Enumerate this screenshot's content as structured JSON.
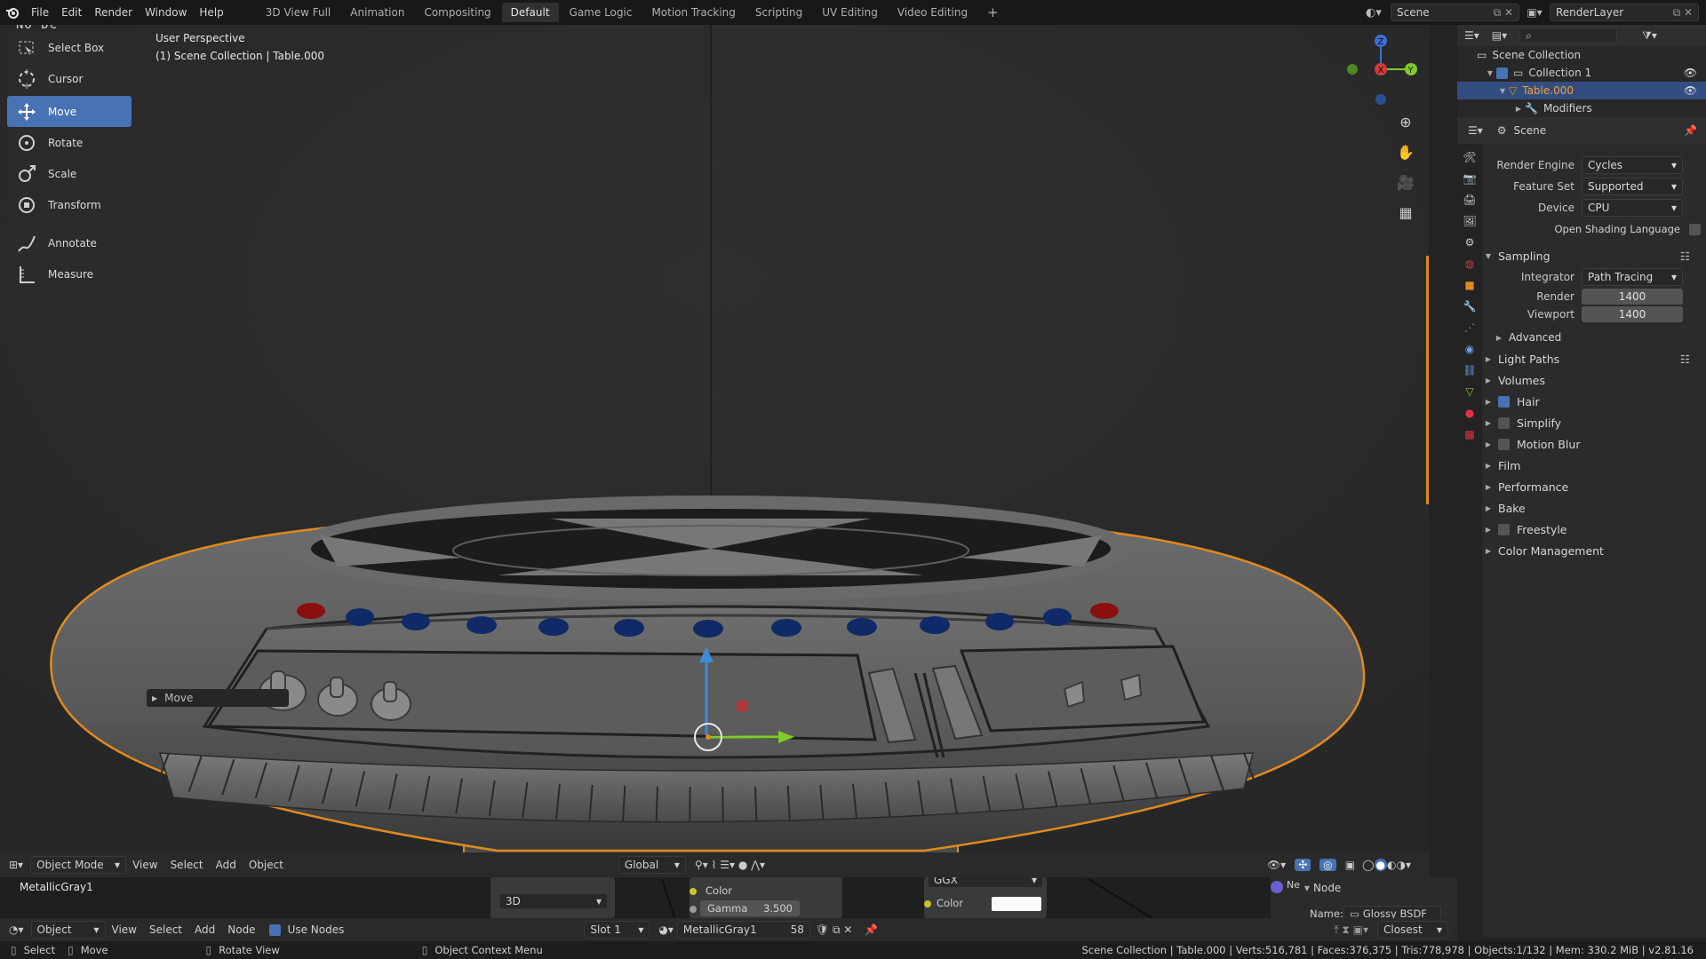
{
  "menu": {
    "items": [
      "File",
      "Edit",
      "Render",
      "Window",
      "Help"
    ],
    "workspaces": [
      "3D View Full",
      "Animation",
      "Compositing",
      "Default",
      "Game Logic",
      "Motion Tracking",
      "Scripting",
      "UV Editing",
      "Video Editing"
    ],
    "active_workspace": "Default",
    "add_tab": "+",
    "scene_name": "Scene",
    "render_layer": "RenderLayer"
  },
  "viewport": {
    "watermark": "NO DC",
    "perspective": "User Perspective",
    "collection_info": "(1) Scene Collection | Table.000",
    "last_op": "Move",
    "tools": [
      {
        "label": "Select Box",
        "icon": "select-box-icon"
      },
      {
        "label": "Cursor",
        "icon": "cursor-icon"
      },
      {
        "label": "Move",
        "icon": "move-icon",
        "active": true
      },
      {
        "label": "Rotate",
        "icon": "rotate-icon"
      },
      {
        "label": "Scale",
        "icon": "scale-icon"
      },
      {
        "label": "Transform",
        "icon": "transform-icon"
      },
      {
        "label": "Annotate",
        "icon": "annotate-icon"
      },
      {
        "label": "Measure",
        "icon": "measure-icon"
      }
    ],
    "gizmo_axes": {
      "x": "X",
      "y": "Y",
      "z": "Z"
    },
    "header": {
      "mode": "Object Mode",
      "menus": [
        "View",
        "Select",
        "Add",
        "Object"
      ],
      "orientation": "Global"
    }
  },
  "outliner": {
    "root": "Scene Collection",
    "items": [
      {
        "label": "Collection 1",
        "depth": 1
      },
      {
        "label": "Table.000",
        "depth": 2,
        "selected": true
      },
      {
        "label": "Modifiers",
        "depth": 3
      }
    ]
  },
  "properties": {
    "context": "Scene",
    "render_engine": {
      "label": "Render Engine",
      "value": "Cycles"
    },
    "feature_set": {
      "label": "Feature Set",
      "value": "Supported"
    },
    "device": {
      "label": "Device",
      "value": "CPU"
    },
    "osl": {
      "label": "Open Shading Language",
      "checked": false
    },
    "sampling": {
      "title": "Sampling",
      "integrator": {
        "label": "Integrator",
        "value": "Path Tracing"
      },
      "render": {
        "label": "Render",
        "value": "1400"
      },
      "viewport": {
        "label": "Viewport",
        "value": "1400"
      },
      "advanced": "Advanced"
    },
    "panels": [
      {
        "label": "Light Paths"
      },
      {
        "label": "Volumes"
      },
      {
        "label": "Hair",
        "checkbox": true,
        "checked": true
      },
      {
        "label": "Simplify",
        "checkbox": true,
        "checked": false
      },
      {
        "label": "Motion Blur",
        "checkbox": true,
        "checked": false
      },
      {
        "label": "Film"
      },
      {
        "label": "Performance"
      },
      {
        "label": "Bake"
      },
      {
        "label": "Freestyle",
        "checkbox": true,
        "checked": false
      },
      {
        "label": "Color Management"
      }
    ]
  },
  "node_editor": {
    "menu": [
      "View",
      "Select",
      "Add",
      "Node"
    ],
    "type": "Object",
    "use_nodes": "Use Nodes",
    "slot": "Slot 1",
    "material": "MetallicGray1",
    "users": "58",
    "label": "MetallicGray1",
    "projection": "3D",
    "color_label": "Color",
    "gamma_label": "Gamma",
    "gamma_value": "3.500",
    "distribution": "GGX",
    "color_socket": "Color",
    "panel_tab": "Node",
    "name_label": "Name:",
    "name_value": "Glossy BSDF",
    "interp": "Closest"
  },
  "statusbar": {
    "select": "Select",
    "move": "Move",
    "rotate": "Rotate View",
    "context": "Object Context Menu",
    "stats": "Scene Collection | Table.000 | Verts:516,781 | Faces:376,375 | Tris:778,978 | Objects:1/132 | Mem: 330.2 MiB | v2.81.16"
  }
}
